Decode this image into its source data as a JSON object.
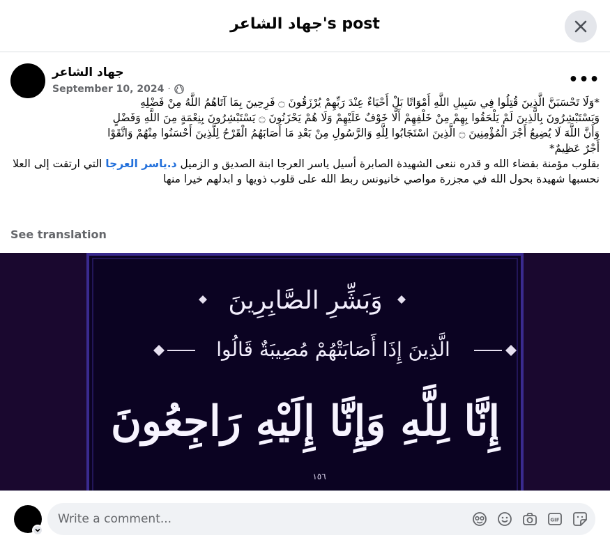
{
  "header": {
    "title": "جهاد الشاعر's post"
  },
  "post": {
    "author": "جهاد الشاعر",
    "date": "September 10, 2024",
    "privacy_icon": "globe-icon",
    "text_lines": [
      "*وَلَا تَحْسَبَنَّ الَّذِينَ قُتِلُوا فِي سَبِيلِ اللَّهِ أَمْوَاتًا بَلْ أَحْيَاءٌ عِنْدَ رَبِّهِمْ يُرْزَقُونَ ۝ فَرِحِينَ بِمَا آتَاهُمُ اللَّهُ مِنْ فَضْلِهِ",
      "وَيَسْتَبْشِرُونَ بِالَّذِينَ لَمْ يَلْحَقُوا بِهِمْ مِنْ خَلْفِهِمْ أَلَّا خَوْفٌ عَلَيْهِمْ وَلَا هُمْ يَحْزَنُونَ ۝ يَسْتَبْشِرُونَ بِنِعْمَةٍ مِنَ اللَّهِ وَفَضْلٍ",
      "وَأَنَّ اللَّهَ لَا يُضِيعُ أَجْرَ الْمُؤْمِنِينَ ۝ الَّذِينَ اسْتَجَابُوا لِلَّهِ وَالرَّسُولِ مِنْ بَعْدِ مَا أَصَابَهُمُ الْقَرْحُ لِلَّذِينَ أَحْسَنُوا مِنْهُمْ وَاتَّقَوْا",
      "أَجْرٌ عَظِيمٌ*"
    ],
    "body_prefix": "بقلوب مؤمنة بقضاء الله و قدره ننعى الشهيدة الصابرة أسيل ياسر العرجا ابنة الصديق و الزميل ",
    "tag": "د.ياسر العرجا",
    "body_rest": "التي ارتقت إلى العلا نحسبها شهيدة بحول الله في مجزرة مواصي خانيونس ربط الله على قلوب ذويها و ابدلهم خيرا منها",
    "see_translation": "See translation",
    "image": {
      "line1": "وَبَشِّرِ الصَّابِرِينَ",
      "line2": "الَّذِينَ إِذَا أَصَابَتْهُمْ مُصِيبَةٌ قَالُوا",
      "line3": "إِنَّا لِلَّهِ وَإِنَّا إِلَيْهِ رَاجِعُونَ",
      "verse_number": "١٥٦",
      "bg_color": "#1a082f",
      "frame_color": "#3a2a8f"
    }
  },
  "comment": {
    "placeholder": "Write a comment...",
    "icons": [
      "avatar-sticker-icon",
      "emoji-icon",
      "camera-icon",
      "gif-icon",
      "sticker-icon"
    ]
  }
}
